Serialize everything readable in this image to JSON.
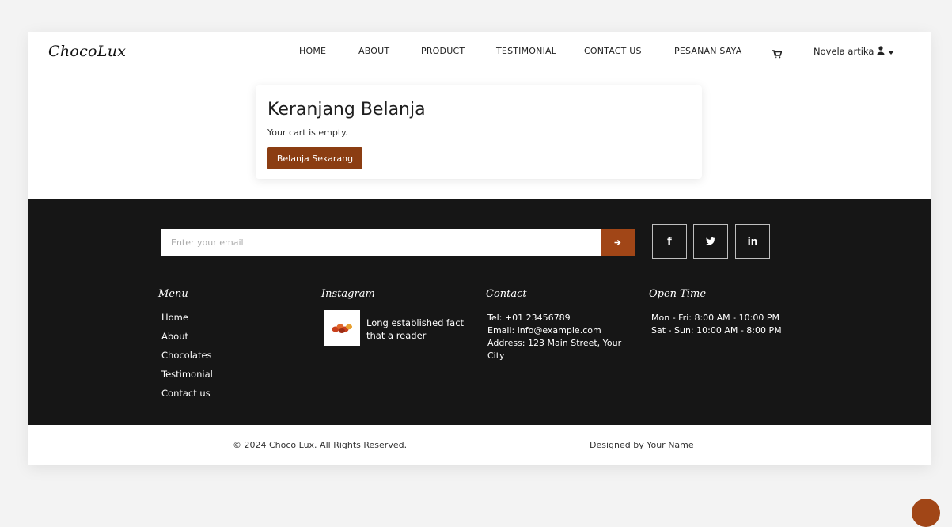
{
  "brand": {
    "logo": "ChocoLux"
  },
  "nav": {
    "items": [
      "HOME",
      "ABOUT",
      "PRODUCT",
      "TESTIMONIAL",
      "CONTACT US",
      "PESANAN SAYA"
    ],
    "cart_icon": "shopping-cart-icon",
    "user_name": "Novela artika",
    "user_icon": "user-icon",
    "caret_icon": "caret-down-icon"
  },
  "cart": {
    "title": "Keranjang Belanja",
    "message": "Your cart is empty.",
    "button_label": "Belanja Sekarang"
  },
  "footer": {
    "newsletter": {
      "placeholder": "Enter your email",
      "submit_icon": "arrow-right-icon"
    },
    "social": [
      {
        "name": "facebook-icon",
        "glyph": "f"
      },
      {
        "name": "twitter-icon",
        "glyph": "🐦"
      },
      {
        "name": "linkedin-icon",
        "glyph": "in"
      }
    ],
    "menu": {
      "title": "Menu",
      "links": [
        "Home",
        "About",
        "Chocolates",
        "Testimonial",
        "Contact us"
      ]
    },
    "instagram": {
      "title": "Instagram",
      "caption": "Long established fact that a reader"
    },
    "contact": {
      "title": "Contact",
      "tel": "Tel: +01 23456789",
      "email": "Email: info@example.com",
      "address": "Address: 123 Main Street, Your City"
    },
    "open_time": {
      "title": "Open Time",
      "weekday": "Mon - Fri: 8:00 AM - 10:00 PM",
      "weekend": "Sat - Sun: 10:00 AM - 8:00 PM"
    }
  },
  "bottom": {
    "copyright": "© 2024 Choco Lux. All Rights Reserved.",
    "designed_by": "Designed by Your Name"
  },
  "colors": {
    "accent": "#a14617",
    "button": "#8b3d12",
    "footer_bg": "#161616"
  }
}
